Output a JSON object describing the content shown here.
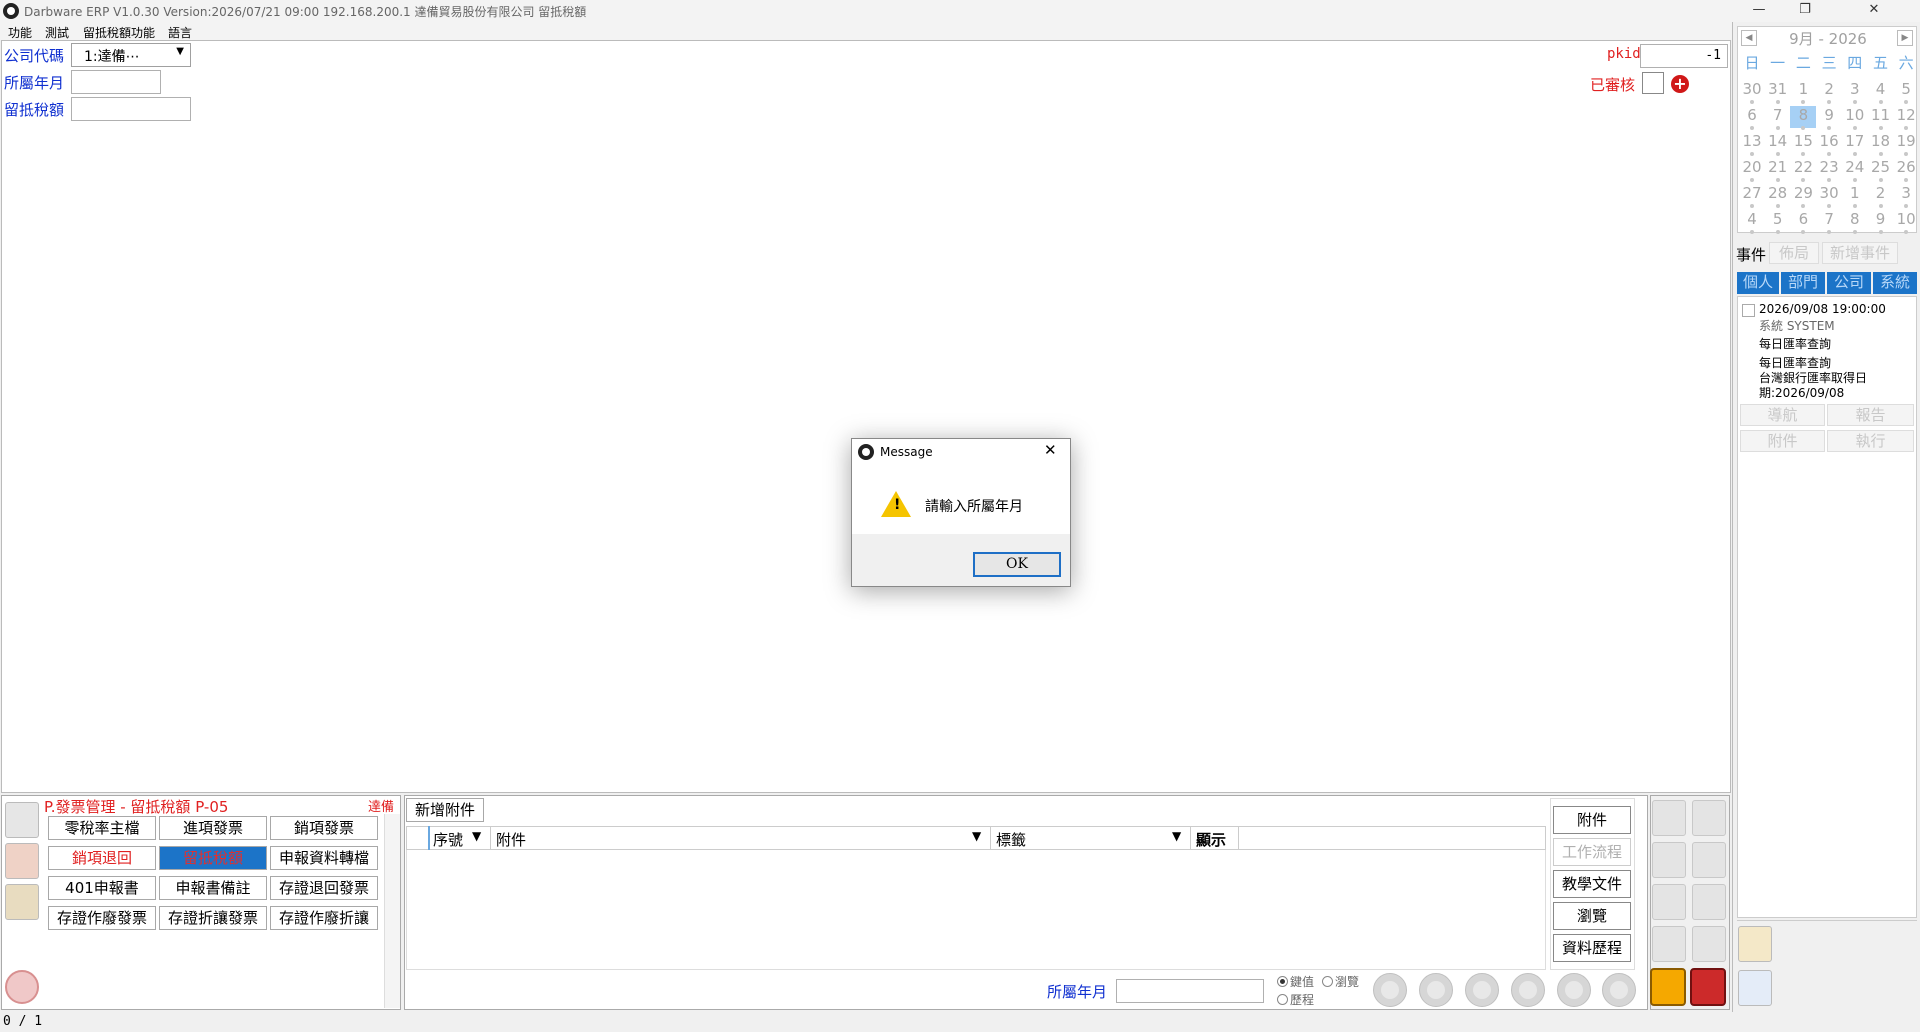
{
  "window": {
    "title": "Darbware ERP V1.0.30 Version:2026/07/21 09:00   192.168.200.1 達備貿易股份有限公司 留抵稅額",
    "minimize": "—",
    "restore": "❐",
    "close": "✕"
  },
  "menu": [
    "功能",
    "測試",
    "留抵稅額功能",
    "語言"
  ],
  "form": {
    "company_label": "公司代碼",
    "company_value": "1:達備⋯",
    "month_label": "所屬年月",
    "month_value": "",
    "tax_label": "留抵稅額",
    "tax_value": "",
    "pkid_label": "pkid",
    "pkid_value": "-1",
    "reviewed_label": "已審核",
    "add_symbol": "+"
  },
  "calendar": {
    "prev": "◀",
    "next": "▶",
    "month_label": "9月  -  2026",
    "weekdays": [
      "日",
      "一",
      "二",
      "三",
      "四",
      "五",
      "六"
    ],
    "weeks": [
      [
        "30",
        "31",
        "1",
        "2",
        "3",
        "4",
        "5"
      ],
      [
        "6",
        "7",
        "8",
        "9",
        "10",
        "11",
        "12"
      ],
      [
        "13",
        "14",
        "15",
        "16",
        "17",
        "18",
        "19"
      ],
      [
        "20",
        "21",
        "22",
        "23",
        "24",
        "25",
        "26"
      ],
      [
        "27",
        "28",
        "29",
        "30",
        "1",
        "2",
        "3"
      ],
      [
        "4",
        "5",
        "6",
        "7",
        "8",
        "9",
        "10"
      ]
    ],
    "selected": "8"
  },
  "events": {
    "title": "事件",
    "layout_btn": "佈局",
    "add_btn": "新增事件",
    "tabs": [
      "個人",
      "部門",
      "公司",
      "系統"
    ],
    "items": [
      {
        "datetime": "2026/09/08 19:00:00",
        "source": "系統  SYSTEM",
        "subject": "每日匯率查詢",
        "body": [
          "每日匯率查詢",
          "台灣銀行匯率取得日",
          "期:2026/09/08"
        ]
      }
    ],
    "actions": [
      "導航",
      "報告",
      "附件",
      "執行"
    ]
  },
  "module_panel": {
    "title": "P.發票管理 - 留抵稅額  P-05",
    "tag": "達備",
    "buttons": [
      "零稅率主檔",
      "進項發票",
      "銷項發票",
      "銷項退回",
      "留抵稅額",
      "申報資料轉檔",
      "401申報書",
      "申報書備註",
      "存證退回發票",
      "存證作廢發票",
      "存證折讓發票",
      "存證作廢折讓"
    ]
  },
  "attachments": {
    "add_button": "新增附件",
    "columns": [
      "序號",
      "附件",
      "標籤",
      "顯示"
    ]
  },
  "side_actions": [
    "附件",
    "工作流程",
    "教學文件",
    "瀏覽",
    "資料歷程"
  ],
  "search": {
    "field_label": "所屬年月",
    "field_value": "",
    "radios": [
      "鍵值",
      "瀏覽",
      "歷程"
    ]
  },
  "status": {
    "record_position": "0  /  1"
  },
  "dialog": {
    "title": "Message",
    "message": "請輸入所屬年月",
    "ok": "OK",
    "close": "✕"
  }
}
